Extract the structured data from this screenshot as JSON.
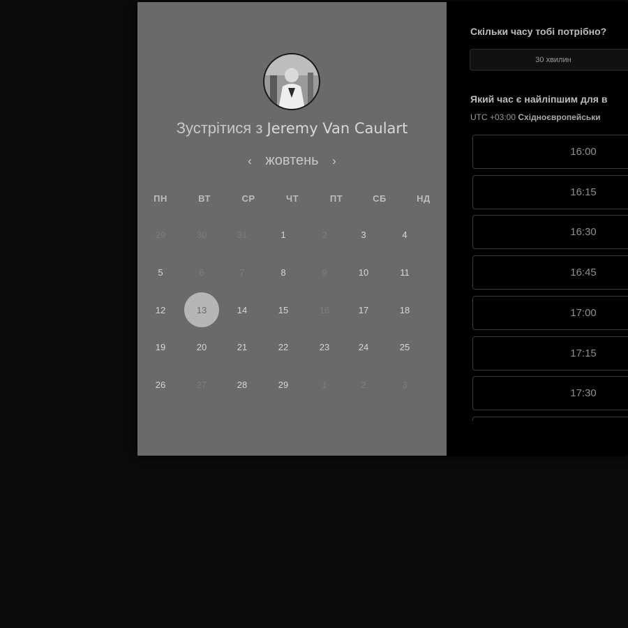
{
  "calendar": {
    "title_prefix": "Зустрітися з",
    "host_name": "Jeremy Van Caulart",
    "avatar_icon": "person-photo-icon",
    "prev_arrow": "‹",
    "next_arrow": "›",
    "month": "жовтень",
    "weekdays": [
      "ПН",
      "ВТ",
      "СР",
      "ЧТ",
      "ПТ",
      "СБ",
      "НД"
    ],
    "weeks": [
      [
        {
          "d": "29",
          "muted": true
        },
        {
          "d": "30",
          "muted": true
        },
        {
          "d": "31",
          "muted": true
        },
        {
          "d": "1",
          "muted": false
        },
        {
          "d": "2",
          "muted": true
        },
        {
          "d": "3",
          "muted": false
        },
        {
          "d": "4",
          "muted": false
        }
      ],
      [
        {
          "d": "5",
          "muted": false
        },
        {
          "d": "6",
          "muted": true
        },
        {
          "d": "7",
          "muted": true
        },
        {
          "d": "8",
          "muted": false
        },
        {
          "d": "9",
          "muted": true
        },
        {
          "d": "10",
          "muted": false
        },
        {
          "d": "11",
          "muted": false
        }
      ],
      [
        {
          "d": "12",
          "muted": false
        },
        {
          "d": "13",
          "muted": false,
          "selected": true
        },
        {
          "d": "14",
          "muted": false
        },
        {
          "d": "15",
          "muted": false
        },
        {
          "d": "16",
          "muted": true
        },
        {
          "d": "17",
          "muted": false
        },
        {
          "d": "18",
          "muted": false
        }
      ],
      [
        {
          "d": "19",
          "muted": false
        },
        {
          "d": "20",
          "muted": false
        },
        {
          "d": "21",
          "muted": false
        },
        {
          "d": "22",
          "muted": false
        },
        {
          "d": "23",
          "muted": false
        },
        {
          "d": "24",
          "muted": false
        },
        {
          "d": "25",
          "muted": false
        }
      ],
      [
        {
          "d": "26",
          "muted": false
        },
        {
          "d": "27",
          "muted": true
        },
        {
          "d": "28",
          "muted": false
        },
        {
          "d": "29",
          "muted": false
        },
        {
          "d": "1",
          "muted": true
        },
        {
          "d": "2",
          "muted": true
        },
        {
          "d": "3",
          "muted": true
        }
      ]
    ]
  },
  "booking": {
    "duration_question": "Скільки часу тобі потрібно?",
    "duration_value": "30 хвилин",
    "time_question": "Який час є найліпшим для в",
    "timezone_offset": "UTC +03:00",
    "timezone_name": "Східноєвропейськи",
    "slots": [
      "16:00",
      "16:15",
      "16:30",
      "16:45",
      "17:00",
      "17:15",
      "17:30",
      ""
    ]
  },
  "colors": {
    "page_bg": "#0b0b0b",
    "calendar_bg": "#6a6a6a",
    "selected_day_bg": "#b5b5b5",
    "panel_bg": "#000000"
  }
}
